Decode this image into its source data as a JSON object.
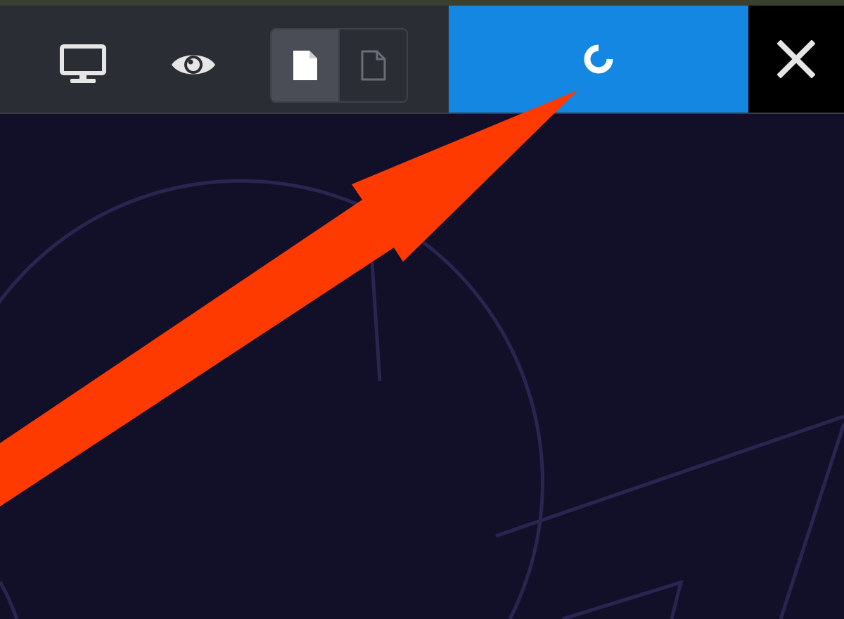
{
  "toolbar": {
    "icons": {
      "desktop": "monitor-icon",
      "preview": "eye-icon",
      "page_filled": "document-filled-icon",
      "page_outline": "document-outline-icon",
      "publish": "loading-spinner-icon",
      "close": "close-icon"
    }
  },
  "colors": {
    "toolbar_bg": "#2b2d35",
    "publish_bg": "#1387e1",
    "close_bg": "#000000",
    "canvas_bg": "#121028",
    "arrow": "#ff3a00"
  }
}
